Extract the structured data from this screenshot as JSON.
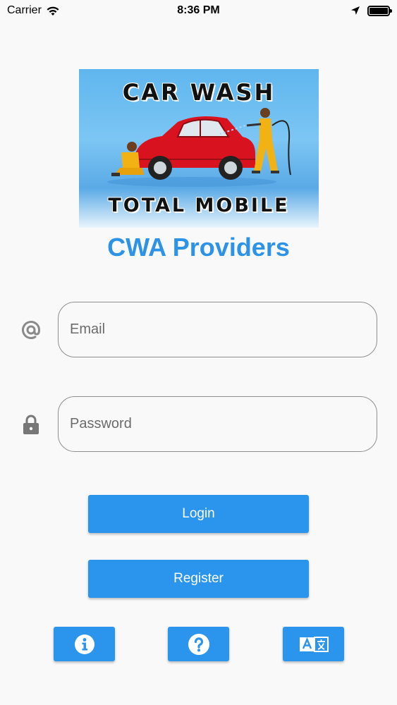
{
  "status_bar": {
    "carrier": "Carrier",
    "time": "8:36 PM"
  },
  "logo": {
    "top_text": "CAR WASH",
    "bottom_text": "TOTAL MOBILE"
  },
  "app_title": "CWA Providers",
  "form": {
    "email": {
      "placeholder": "Email",
      "value": "",
      "icon": "at-icon"
    },
    "password": {
      "placeholder": "Password",
      "value": "",
      "icon": "lock-icon"
    }
  },
  "buttons": {
    "login_label": "Login",
    "register_label": "Register"
  },
  "footer_icons": [
    "info-icon",
    "help-icon",
    "translate-icon"
  ],
  "colors": {
    "accent": "#2b95ee",
    "title": "#2c93e6",
    "background": "#f9f9f9",
    "border": "#8f8f8f"
  }
}
